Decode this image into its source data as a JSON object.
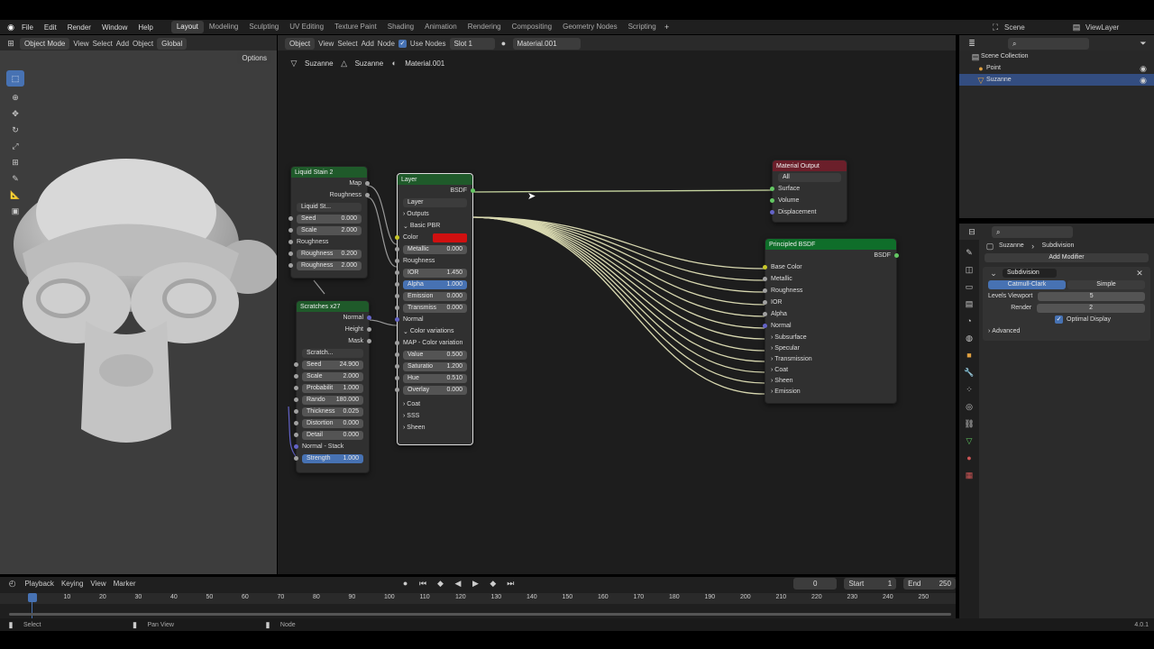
{
  "top_menu": {
    "items": [
      "File",
      "Edit",
      "Render",
      "Window",
      "Help"
    ]
  },
  "workspaces": [
    "Layout",
    "Modeling",
    "Sculpting",
    "UV Editing",
    "Texture Paint",
    "Shading",
    "Animation",
    "Rendering",
    "Compositing",
    "Geometry Nodes",
    "Scripting"
  ],
  "active_workspace": "Layout",
  "scene": {
    "name": "Scene",
    "view_layer": "ViewLayer"
  },
  "viewport_header": {
    "mode": "Object Mode",
    "menus": [
      "View",
      "Select",
      "Add",
      "Object"
    ],
    "transform": "Global",
    "options": "Options"
  },
  "node_header": {
    "type": "Object",
    "menus": [
      "View",
      "Select",
      "Add",
      "Node"
    ],
    "use_nodes": "Use Nodes",
    "slot": "Slot 1",
    "material": "Material.001"
  },
  "breadcrumb": [
    "Suzanne",
    "Suzanne",
    "Material.001"
  ],
  "nodes": {
    "liquid_stain": {
      "title": "Liquid Stain 2",
      "outputs": [
        "Map",
        "Roughness"
      ],
      "group": "Liquid St...",
      "roughness_label": "Roughness",
      "fields": [
        {
          "label": "Seed",
          "value": "0.000"
        },
        {
          "label": "Scale",
          "value": "2.000"
        }
      ],
      "fields2": [
        {
          "label": "Roughness",
          "value": "0.200"
        },
        {
          "label": "Roughness",
          "value": "2.000"
        }
      ]
    },
    "scratches": {
      "title": "Scratches x27",
      "outputs": [
        "Normal",
        "Height",
        "Mask"
      ],
      "group": "Scratch...",
      "fields": [
        {
          "label": "Seed",
          "value": "24.900"
        },
        {
          "label": "Scale",
          "value": "2.000"
        },
        {
          "label": "Probabilit",
          "value": "1.000"
        },
        {
          "label": "Rando",
          "value": "180.000"
        },
        {
          "label": "Thickness",
          "value": "0.025"
        },
        {
          "label": "Distortion",
          "value": "0.000"
        },
        {
          "label": "Detail",
          "value": "0.000"
        }
      ],
      "normal_stack": "Normal - Stack",
      "strength": {
        "label": "Strength",
        "value": "1.000"
      }
    },
    "layer": {
      "title": "Layer",
      "output": "BSDF",
      "group": "Layer",
      "outputs_label": "Outputs",
      "basic_pbr": "Basic PBR",
      "color_label": "Color",
      "metallic": {
        "label": "Metallic",
        "value": "0.000"
      },
      "roughness_label": "Roughness",
      "fields": [
        {
          "label": "IOR",
          "value": "1.450"
        },
        {
          "label": "Alpha",
          "value": "1.000"
        },
        {
          "label": "Emission",
          "value": "0.000"
        },
        {
          "label": "Transmiss",
          "value": "0.000"
        }
      ],
      "normal_label": "Normal",
      "color_variations": "Color variations",
      "map_variation": "MAP - Color variation",
      "fields2": [
        {
          "label": "Value",
          "value": "0.500"
        },
        {
          "label": "Saturatio",
          "value": "1.200"
        },
        {
          "label": "Hue",
          "value": "0.510"
        },
        {
          "label": "Overlay",
          "value": "0.000"
        }
      ],
      "sections": [
        "Coat",
        "SSS",
        "Sheen"
      ]
    },
    "material_output": {
      "title": "Material Output",
      "target": "All",
      "inputs": [
        "Surface",
        "Volume",
        "Displacement"
      ]
    },
    "principled": {
      "title": "Principled BSDF",
      "output": "BSDF",
      "inputs": [
        "Base Color",
        "Metallic",
        "Roughness",
        "IOR",
        "Alpha",
        "Normal"
      ],
      "panels": [
        "Subsurface",
        "Specular",
        "Transmission",
        "Coat",
        "Sheen",
        "Emission"
      ]
    }
  },
  "outliner": {
    "title": "Scene Collection",
    "items": [
      "Point",
      "Suzanne"
    ]
  },
  "properties": {
    "object": "Suzanne",
    "modifier_name": "Subdivision",
    "add_modifier": "Add Modifier",
    "tabs": [
      "Catmull-Clark",
      "Simple"
    ],
    "levels_viewport": {
      "label": "Levels Viewport",
      "value": "5"
    },
    "render": {
      "label": "Render",
      "value": "2"
    },
    "optimal_display": "Optimal Display",
    "advanced": "Advanced"
  },
  "timeline": {
    "menus": [
      "Playback",
      "Keying",
      "View",
      "Marker"
    ],
    "current_frame": "0",
    "start_label": "Start",
    "start": "1",
    "end_label": "End",
    "end": "250",
    "ticks": [
      "0",
      "10",
      "20",
      "30",
      "40",
      "50",
      "60",
      "70",
      "80",
      "90",
      "100",
      "110",
      "120",
      "130",
      "140",
      "150",
      "160",
      "170",
      "180",
      "190",
      "200",
      "210",
      "220",
      "230",
      "240",
      "250"
    ]
  },
  "status_bar": {
    "items": [
      "Select",
      "Pan View",
      "Node"
    ],
    "version": "4.0.1"
  },
  "colors": {
    "accent": "#4772b3",
    "layer_color": "#d01010",
    "shader_header": "#0f6e2a",
    "output_header": "#6b1f2a",
    "group_header": "#1f5a2a"
  }
}
